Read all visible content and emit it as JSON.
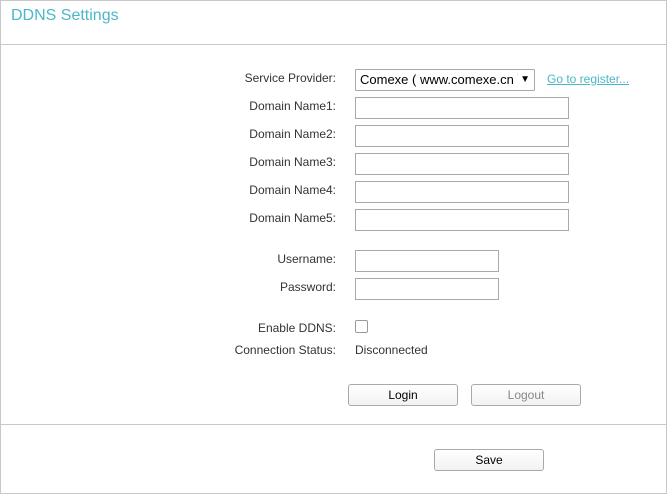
{
  "header": {
    "title": "DDNS Settings"
  },
  "form": {
    "service_provider_label": "Service Provider:",
    "service_provider_value": "Comexe ( www.comexe.cn )",
    "register_link": "Go to register...",
    "domain_labels": [
      "Domain Name1:",
      "Domain Name2:",
      "Domain Name3:",
      "Domain Name4:",
      "Domain Name5:"
    ],
    "domain_values": [
      "",
      "",
      "",
      "",
      ""
    ],
    "username_label": "Username:",
    "username_value": "",
    "password_label": "Password:",
    "password_value": "",
    "enable_label": "Enable DDNS:",
    "enable_checked": false,
    "status_label": "Connection Status:",
    "status_value": "Disconnected"
  },
  "buttons": {
    "login": "Login",
    "logout": "Logout",
    "save": "Save"
  },
  "colors": {
    "accent": "#4ab8c9",
    "border": "#c8c8c8"
  }
}
